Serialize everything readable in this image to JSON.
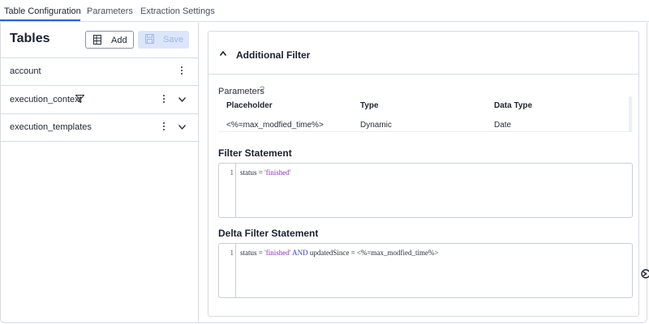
{
  "tabs": [
    {
      "label": "Table Configuration",
      "active": true
    },
    {
      "label": "Parameters",
      "active": false
    },
    {
      "label": "Extraction Settings",
      "active": false
    }
  ],
  "left_panel": {
    "title": "Tables",
    "add_label": "Add",
    "save_label": "Save",
    "tables": [
      {
        "name": "account",
        "has_filter": false,
        "expandable": false
      },
      {
        "name": "execution_context",
        "has_filter": true,
        "expandable": true
      },
      {
        "name": "execution_templates",
        "has_filter": false,
        "expandable": true
      }
    ]
  },
  "right_panel": {
    "section_title": "Additional Filter",
    "parameters_label": "Parameters",
    "help_glyph": "?",
    "params_table": {
      "headers": [
        "Placeholder",
        "Type",
        "Data Type"
      ],
      "rows": [
        [
          "<%=max_modfied_time%>",
          "Dynamic",
          "Date"
        ]
      ]
    },
    "filter_statement": {
      "label": "Filter Statement",
      "line_number": "1",
      "code_prefix": "status = ",
      "code_string": "'finished'"
    },
    "delta_filter_statement": {
      "label": "Delta Filter Statement",
      "line_number": "1",
      "code_prefix": "status = ",
      "code_string": "'finished'",
      "code_keyword": " AND ",
      "code_suffix": "updatedSince = <%=max_modfied_time%>"
    }
  },
  "colors": {
    "accent": "#2f5be7",
    "string_token": "#8f2fb6",
    "keyword_token": "#3b47c7",
    "save_disabled_bg": "#dce6fb"
  }
}
